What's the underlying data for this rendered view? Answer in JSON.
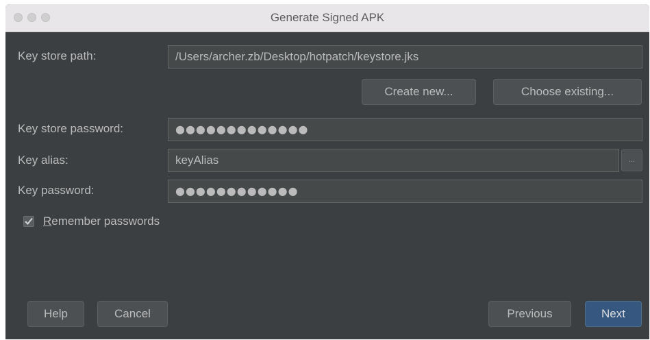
{
  "window": {
    "title": "Generate Signed APK"
  },
  "form": {
    "key_store_path_label": "Key store path:",
    "key_store_path_value": "/Users/archer.zb/Desktop/hotpatch/keystore.jks",
    "create_new_label": "Create new...",
    "choose_existing_label": "Choose existing...",
    "key_store_password_label": "Key store password:",
    "key_store_password_value": "●●●●●●●●●●●●●",
    "key_alias_label": "Key alias:",
    "key_alias_value": "keyAlias",
    "browse_label": "...",
    "key_password_label": "Key password:",
    "key_password_value": "●●●●●●●●●●●●",
    "remember_mnemonic": "R",
    "remember_rest": "emember passwords",
    "remember_checked": true
  },
  "footer": {
    "help_label": "Help",
    "cancel_label": "Cancel",
    "previous_label": "Previous",
    "next_label": "Next"
  },
  "colors": {
    "background": "#3c3f41",
    "field": "#45494a",
    "text": "#bbbbbb",
    "primary_button": "#365880"
  }
}
